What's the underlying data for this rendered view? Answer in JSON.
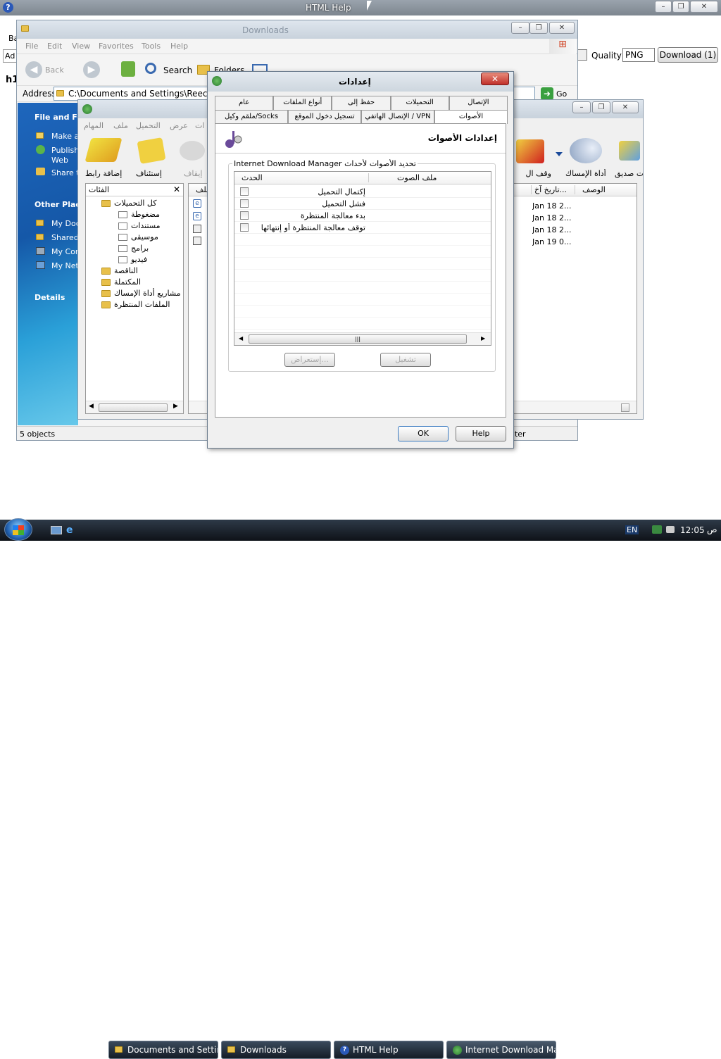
{
  "topwin": {
    "title": "HTML Help"
  },
  "bg": {
    "quality_label": "Quality",
    "quality_value": "PNG",
    "download_btn": "Download (1)",
    "ad": "Ad",
    "ba": "Ba",
    "h1": "h1"
  },
  "explorer": {
    "title": "Downloads",
    "menu": [
      "File",
      "Edit",
      "View",
      "Favorites",
      "Tools",
      "Help"
    ],
    "back": "Back",
    "search": "Search",
    "folders": "Folders",
    "address_label": "Address",
    "address_value": "C:\\Documents and Settings\\Reece Labso",
    "go": "Go",
    "status": "5 objects",
    "status_right": "uter",
    "left": {
      "section1": "File and Fol",
      "tasks": [
        "Make a",
        "Publish Web",
        "Share t"
      ],
      "section2": "Other Place",
      "places": [
        "My Doc",
        "Shared",
        "My Com",
        "My Netw"
      ],
      "section3": "Details"
    }
  },
  "idm": {
    "menu": [
      "ات",
      "عرض",
      "التحميل",
      "ملف",
      "المهام"
    ],
    "toolbar_left": [
      {
        "label": "إضافة رابط"
      },
      {
        "label": "إستئناف"
      },
      {
        "label": "إيقاف"
      }
    ],
    "toolbar_right": [
      {
        "label": "ت صديق"
      },
      {
        "label": "أداة الإمساك"
      },
      {
        "label": "وقف ال"
      }
    ],
    "categories_title": "الفئات",
    "tree": [
      {
        "label": "كل التحميلات",
        "level": 0
      },
      {
        "label": "مضغوطة",
        "level": 1
      },
      {
        "label": "مستندات",
        "level": 1
      },
      {
        "label": "موسيقى",
        "level": 1
      },
      {
        "label": "برامج",
        "level": 1
      },
      {
        "label": "فيديو",
        "level": 1
      },
      {
        "label": "الناقصة",
        "level": 0
      },
      {
        "label": "المكتملة",
        "level": 0
      },
      {
        "label": "مشاريع أداة الإمساك",
        "level": 0
      },
      {
        "label": "الملفات المنتظرة",
        "level": 0
      }
    ],
    "col_desc": "الوصف",
    "col_date": "تاريخ آخ...",
    "col_file": "ملف",
    "dates": [
      "Jan 18 2...",
      "Jan 18 2...",
      "Jan 18 2...",
      "Jan 19 0..."
    ]
  },
  "dialog": {
    "title": "إعدادات",
    "tabs_row1": [
      "الإتصال",
      "التحميلات",
      "حفظ إلى",
      "أنواع الملفات",
      "عام"
    ],
    "tabs_row2": [
      "الأصوات",
      "VPN / الإتصال الهاتفي",
      "تسجيل دخول الموقع",
      "Socks/ملقم وكيل"
    ],
    "heading": "إعدادات الأصوات",
    "group_label": "تحديد الأصوات لأحداث Internet Download Manager",
    "col_event": "الحدث",
    "col_sound": "ملف الصوت",
    "events": [
      "إكتمال التحميل",
      "فشل التحميل",
      "بدء معالجة المنتظرة",
      "توقف معالجة المنتظرة أو إنتهائها"
    ],
    "btn_play": "تشغيل",
    "btn_browse": "إستعراض...",
    "ok": "OK",
    "help": "Help"
  },
  "taskbar": {
    "items": [
      "Documents and Settings",
      "Downloads",
      "HTML Help",
      "Internet Download Ma..."
    ],
    "lang": "EN",
    "time": "12:05",
    "ampm": "ص"
  },
  "colors": {
    "taskbar": "#18222e",
    "sidebar": "#1a5fb0",
    "dialog_bg": "#f0f0f0"
  }
}
